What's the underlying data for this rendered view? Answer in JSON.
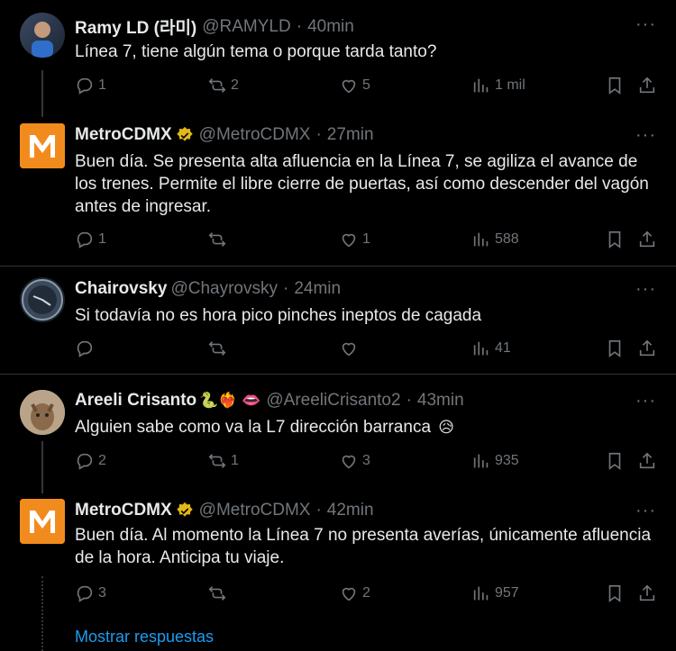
{
  "tweets": [
    {
      "name": "Ramy LD (라미)",
      "handle": "@RAMYLD",
      "time": "40min",
      "text": "Línea 7, tiene algún tema o porque tarda tanto?",
      "replies": "1",
      "retweets": "2",
      "likes": "5",
      "views": "1 mil"
    },
    {
      "name": "MetroCDMX",
      "handle": "@MetroCDMX",
      "time": "27min",
      "text": "Buen día. Se presenta alta afluencia en la Línea 7, se agiliza el avance de los trenes. Permite el libre cierre de puertas, así como descender del vagón antes de ingresar.",
      "replies": "1",
      "retweets": "",
      "likes": "1",
      "views": "588"
    },
    {
      "name": "Chairovsky",
      "handle": "@Chayrovsky",
      "time": "24min",
      "text": "Si todavía no es hora pico pinches ineptos de cagada",
      "replies": "",
      "retweets": "",
      "likes": "",
      "views": "41"
    },
    {
      "name": "Areeli Crisanto",
      "handle": "@AreeliCrisanto2",
      "time": "43min",
      "text": "Alguien sabe como va la L7 dirección barranca",
      "replies": "2",
      "retweets": "1",
      "likes": "3",
      "views": "935",
      "name_emojis": "🐍❤️‍🔥 👄",
      "text_emoji": "😥"
    },
    {
      "name": "MetroCDMX",
      "handle": "@MetroCDMX",
      "time": "42min",
      "text": "Buen día. Al momento la Línea 7 no presenta averías, únicamente afluencia de la hora. Anticipa tu viaje.",
      "replies": "3",
      "retweets": "",
      "likes": "2",
      "views": "957"
    }
  ],
  "more_label": "···",
  "dot": "·",
  "show_replies": "Mostrar respuestas"
}
